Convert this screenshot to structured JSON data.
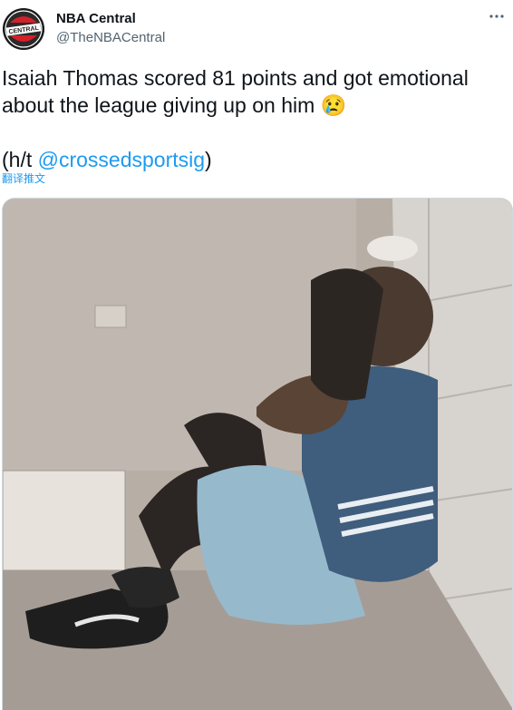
{
  "user": {
    "display_name": "NBA Central",
    "handle": "@TheNBACentral",
    "avatar_text": "CENTRAL"
  },
  "tweet": {
    "line1": "Isaiah Thomas scored 81 points and got emotional",
    "line2": "about the league giving up on him",
    "emoji": "😢",
    "credit_prefix": "(h/t ",
    "credit_mention": "@crossedsportsig",
    "credit_suffix": ")"
  },
  "translate_label": "翻译推文",
  "icons": {
    "more": "more-horizontal-icon",
    "avatar": "nba-central-logo"
  },
  "colors": {
    "link": "#1d9bf0",
    "secondary_text": "#536471"
  }
}
